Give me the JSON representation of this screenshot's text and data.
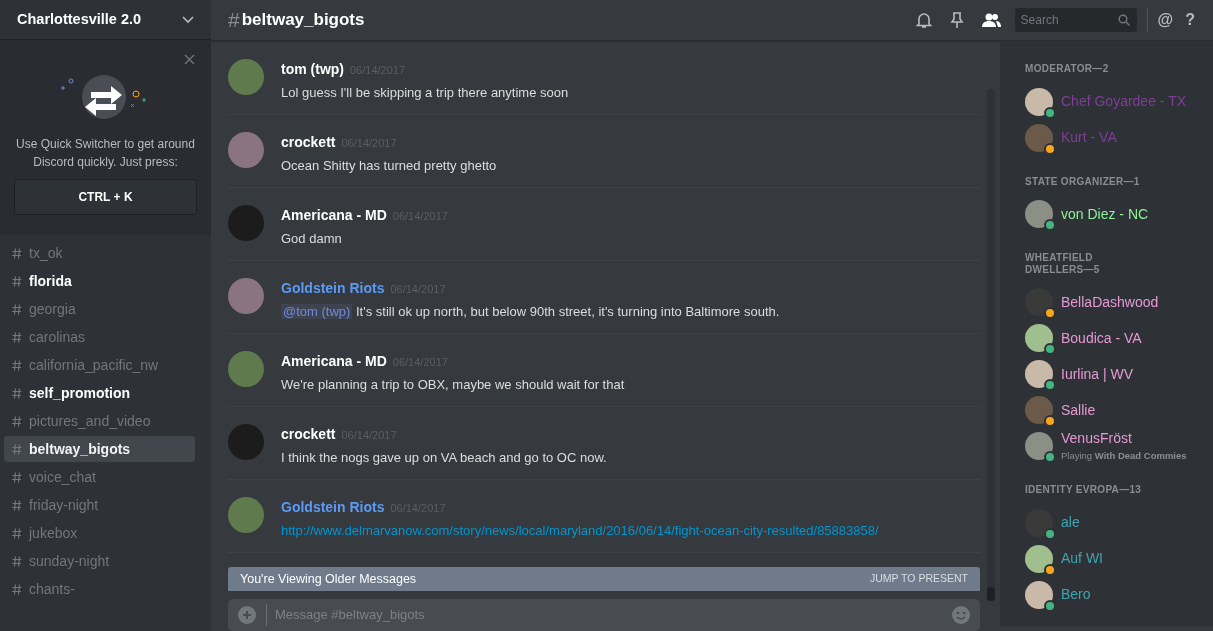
{
  "server": {
    "name": "Charlottesville 2.0"
  },
  "quick_switcher": {
    "text": "Use Quick Switcher to get around Discord quickly. Just press:",
    "shortcut": "CTRL + K"
  },
  "channels": [
    {
      "name": "tx_ok",
      "unread": false,
      "selected": false
    },
    {
      "name": "florida",
      "unread": true,
      "selected": false
    },
    {
      "name": "georgia",
      "unread": false,
      "selected": false
    },
    {
      "name": "carolinas",
      "unread": false,
      "selected": false
    },
    {
      "name": "california_pacific_nw",
      "unread": false,
      "selected": false
    },
    {
      "name": "self_promotion",
      "unread": true,
      "selected": false
    },
    {
      "name": "pictures_and_video",
      "unread": false,
      "selected": false
    },
    {
      "name": "beltway_bigots",
      "unread": false,
      "selected": true
    },
    {
      "name": "voice_chat",
      "unread": false,
      "selected": false
    },
    {
      "name": "friday-night",
      "unread": false,
      "selected": false
    },
    {
      "name": "jukebox",
      "unread": false,
      "selected": false
    },
    {
      "name": "sunday-night",
      "unread": false,
      "selected": false
    },
    {
      "name": "chants-",
      "unread": false,
      "selected": false
    }
  ],
  "header": {
    "hash": "#",
    "channel": "beltway_bigots",
    "search": {
      "placeholder": "Search"
    },
    "at": "@",
    "help": "?"
  },
  "messages": [
    {
      "author": "tom (twp)",
      "color": "#ffffff",
      "time": "06/14/2017",
      "text": "Lol guess I'll be skipping a trip there anytime soon"
    },
    {
      "author": "crockett",
      "color": "#ffffff",
      "time": "06/14/2017",
      "text": "Ocean Shitty has turned pretty ghetto"
    },
    {
      "author": "Americana - MD",
      "color": "#ffffff",
      "time": "06/14/2017",
      "text": "God damn"
    },
    {
      "author": "Goldstein Riots",
      "color": "#5b9bf5",
      "time": "06/14/2017",
      "mention": "@tom (twp)",
      "text": "It's still ok up north, but below 90th street, it's turning into Baltimore south."
    },
    {
      "author": "Americana - MD",
      "color": "#ffffff",
      "time": "06/14/2017",
      "text": "We're planning a trip to OBX, maybe we should wait for that"
    },
    {
      "author": "crockett",
      "color": "#ffffff",
      "time": "06/14/2017",
      "text": "I think the nogs gave up on VA beach and go to OC now."
    },
    {
      "author": "Goldstein Riots",
      "color": "#5b9bf5",
      "time": "06/14/2017",
      "link": "http://www.delmarvanow.com/story/news/local/maryland/2016/06/14/fight-ocean-city-resulted/85883858/"
    }
  ],
  "older_bar": {
    "text": "You're Viewing Older Messages",
    "action": "JUMP TO PRESENT"
  },
  "composer": {
    "placeholder": "Message #beltway_bigots"
  },
  "member_groups": [
    {
      "title": "MODERATOR—2",
      "color": "#7e3f98",
      "members": [
        {
          "name": "Chef Goyardee - TX",
          "color": "#43b581"
        },
        {
          "name": "Kurt - VA",
          "color": "#faa61a"
        }
      ]
    },
    {
      "title": "STATE ORGANIZER—1",
      "color": "#8cf59b",
      "members": [
        {
          "name": "von Diez - NC",
          "color": "#43b581"
        }
      ]
    },
    {
      "title": "WHEATFIELD DWELLERS—5",
      "color": "#e59ad4",
      "members": [
        {
          "name": "BellaDashwood",
          "color": "#faa61a"
        },
        {
          "name": "Boudica - VA",
          "color": "#43b581"
        },
        {
          "name": "Iurlina | WV",
          "color": "#43b581"
        },
        {
          "name": "Sallie",
          "color": "#faa61a"
        },
        {
          "name": "VenusFröst",
          "color": "#43b581",
          "activity": "Playing **With Dead Commies**"
        }
      ]
    },
    {
      "title": "IDENTITY EVROPA—13",
      "color": "#3fa5b0",
      "members": [
        {
          "name": "ale",
          "color": "#43b581"
        },
        {
          "name": "Auf WI",
          "color": "#faa61a"
        },
        {
          "name": "Bero",
          "color": "#43b581"
        }
      ]
    }
  ]
}
